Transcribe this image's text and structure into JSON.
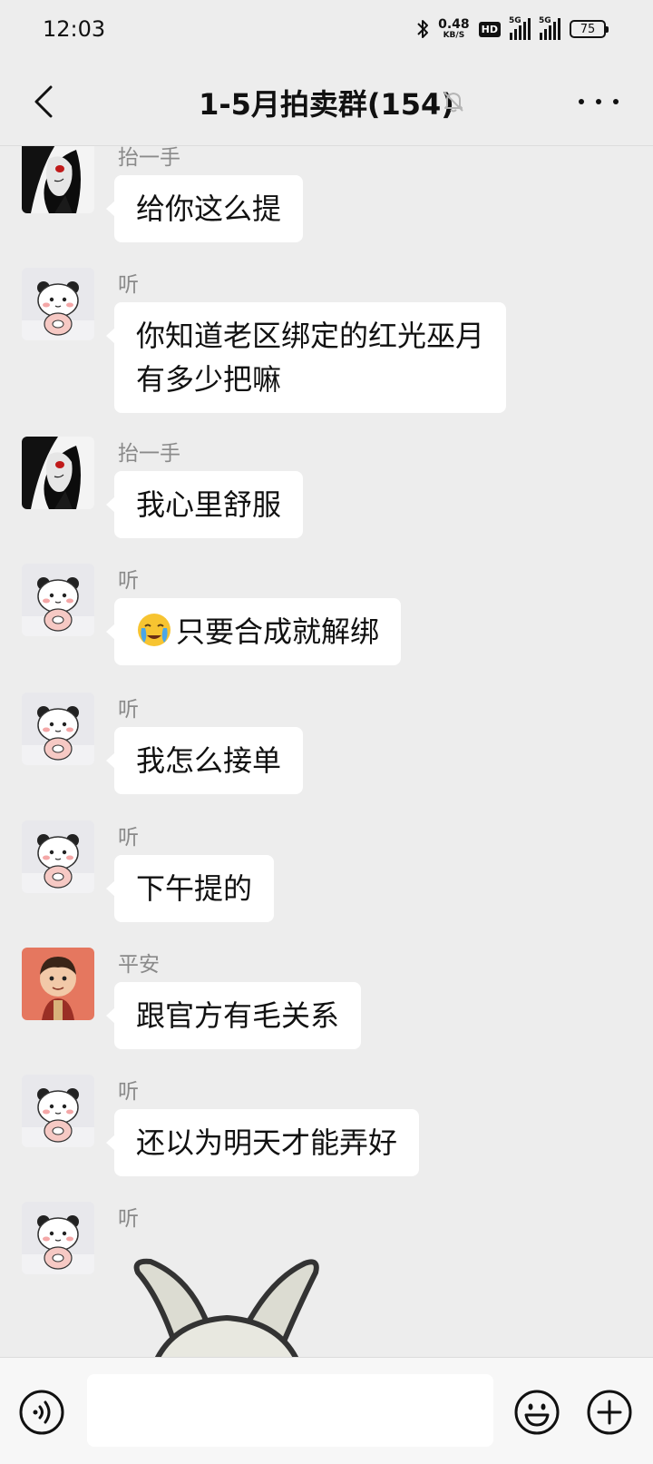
{
  "status_bar": {
    "time": "12:03",
    "net_speed_value": "0.48",
    "net_speed_unit": "KB/S",
    "hd_badge": "HD",
    "signal1_label": "5G",
    "signal2_label": "5G",
    "battery": "75"
  },
  "nav": {
    "title": "1-5月拍卖群(154)"
  },
  "messages": [
    {
      "sender": "抬一手",
      "text": "给你这么提"
    },
    {
      "sender": "听",
      "text": "你知道老区绑定的红光巫月",
      "text2": "有多少把嘛"
    },
    {
      "sender": "抬一手",
      "text": "我心里舒服"
    },
    {
      "sender": "听",
      "emoji": "crying-emoji",
      "text": "只要合成就解绑"
    },
    {
      "sender": "听",
      "text": "我怎么接单"
    },
    {
      "sender": "听",
      "text": "下午提的"
    },
    {
      "sender": "平安",
      "text": "跟官方有毛关系"
    },
    {
      "sender": "听",
      "text": "还以为明天才能弄好"
    },
    {
      "sender": "听",
      "sticker": "rabbit-sticker"
    }
  ],
  "input": {
    "placeholder": ""
  },
  "colors": {
    "background": "#ededed",
    "bubble": "#ffffff",
    "sender_name": "#8a8a8a",
    "input_bar": "#f7f7f7"
  }
}
